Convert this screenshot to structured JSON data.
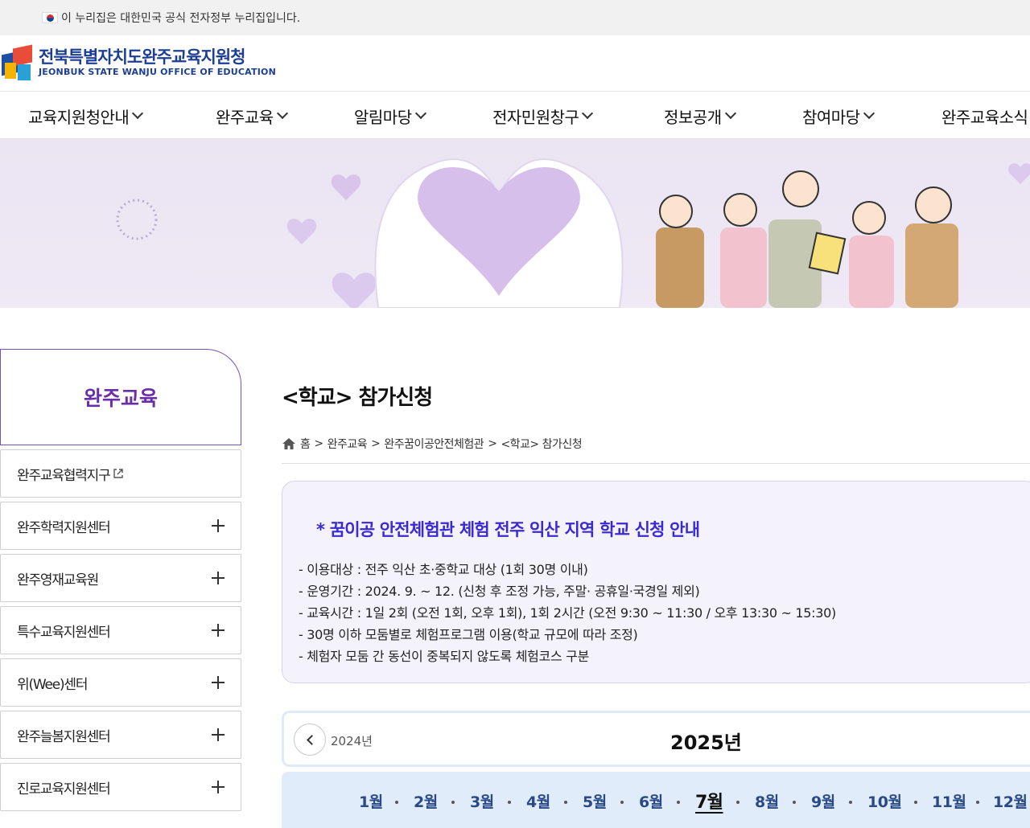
{
  "gov_notice": "이 누리집은 대한민국 공식 전자정부 누리집입니다.",
  "logo": {
    "ko": "전북특별자치도완주교육지원청",
    "en": "JEONBUK STATE WANJU OFFICE OF EDUCATION"
  },
  "gnb": [
    "교육지원청안내",
    "완주교육",
    "알림마당",
    "전자민원창구",
    "정보공개",
    "참여마당",
    "완주교육소식"
  ],
  "sidebar": {
    "title": "완주교육",
    "items": [
      {
        "label": "완주교육협력지구",
        "external": true
      },
      {
        "label": "완주학력지원센터"
      },
      {
        "label": "완주영재교육원"
      },
      {
        "label": "특수교육지원센터"
      },
      {
        "label": "위(Wee)센터"
      },
      {
        "label": "완주늘봄지원센터"
      },
      {
        "label": "진로교육지원센터"
      }
    ]
  },
  "page": {
    "title": "<학교> 참가신청",
    "breadcrumb": [
      "홈",
      "완주교육",
      "완주꿈이공안전체험관",
      "<학교> 참가신청"
    ]
  },
  "info": {
    "title": "* 꿈이공 안전체험관 체험 전주 익산 지역 학교 신청 안내",
    "lines": [
      "- 이용대상 : 전주 익산 초·중학교 대상 (1회 30명 이내)",
      "- 운영기간 : 2024. 9. ~ 12. (신청 후 조정 가능, 주말· 공휴일·국경일 제외)",
      "- 교육시간 : 1일 2회 (오전 1회, 오후 1회), 1회 2시간 (오전 9:30 ~ 11:30 / 오후 13:30 ~ 15:30)",
      "- 30명 이하 모둠별로 체험프로그램 이용(학교 규모에 따라 조정)",
      "- 체험자 모둠 간 동선이 중복되지 않도록 체험코스 구분"
    ]
  },
  "calendar": {
    "prev_year": "2024년",
    "current_year": "2025년",
    "months": [
      "1월",
      "2월",
      "3월",
      "4월",
      "5월",
      "6월",
      "7월",
      "8월",
      "9월",
      "10월",
      "11월",
      "12월"
    ],
    "active_month": "7월"
  },
  "colors": {
    "brand": "#1c3f94",
    "accent": "#6a2fa8",
    "info_title": "#3a2ad0",
    "month_bar": "#e1ecfb"
  },
  "icons": {
    "home": "home-icon",
    "external": "external-link-icon",
    "expand": "plus-icon",
    "prev": "chevron-left-icon",
    "menu_open": "chevron-down-icon"
  }
}
